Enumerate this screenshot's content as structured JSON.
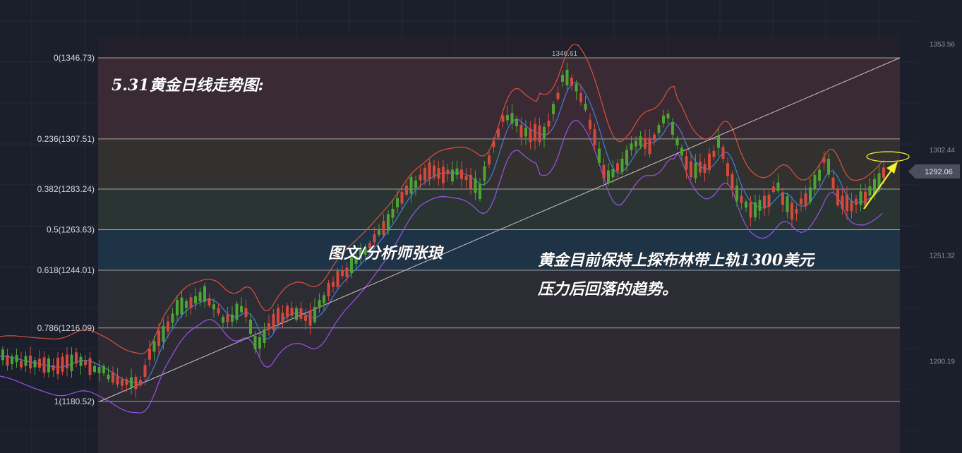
{
  "header": {
    "title": "5.31黄金日线走势图:",
    "author": "图文/分析师张琅"
  },
  "annotation": {
    "line1": "黄金目前保持上探布林带上轨1300美元",
    "line2": "压力后回落的趋势。"
  },
  "chart_data": {
    "type": "candlestick",
    "fibonacci_levels": [
      {
        "label": "0(1346.73)",
        "ratio": 0,
        "price": 1346.73
      },
      {
        "label": "0.236(1307.51)",
        "ratio": 0.236,
        "price": 1307.51
      },
      {
        "label": "0.382(1283.24)",
        "ratio": 0.382,
        "price": 1283.24
      },
      {
        "label": "0.5(1263.63)",
        "ratio": 0.5,
        "price": 1263.63
      },
      {
        "label": "0.618(1244.01)",
        "ratio": 0.618,
        "price": 1244.01
      },
      {
        "label": "0.786(1216.09)",
        "ratio": 0.786,
        "price": 1216.09
      },
      {
        "label": "1(1180.52)",
        "ratio": 1,
        "price": 1180.52
      }
    ],
    "price_axis_ticks": [
      "1353.56",
      "1302.44",
      "1251.32",
      "1200.19"
    ],
    "price_axis_values": [
      1353.56,
      1302.44,
      1251.32,
      1200.19
    ],
    "current_price": {
      "label": "1292.06",
      "value": 1292.06
    },
    "peak_label": {
      "label": "1346.61",
      "value": 1346.61
    },
    "indicators": [
      "Bollinger Bands (upper / middle / lower)",
      "Trend line"
    ],
    "colors": {
      "up": "#4ea335",
      "down": "#d24a3e",
      "bb_upper": "#d8513f",
      "bb_middle": "#3d7fe0",
      "bb_lower": "#9a52e6",
      "trendline": "#c9c3c3",
      "arrow": "#f4f22b",
      "fib_line": "#c9c9c9"
    }
  }
}
